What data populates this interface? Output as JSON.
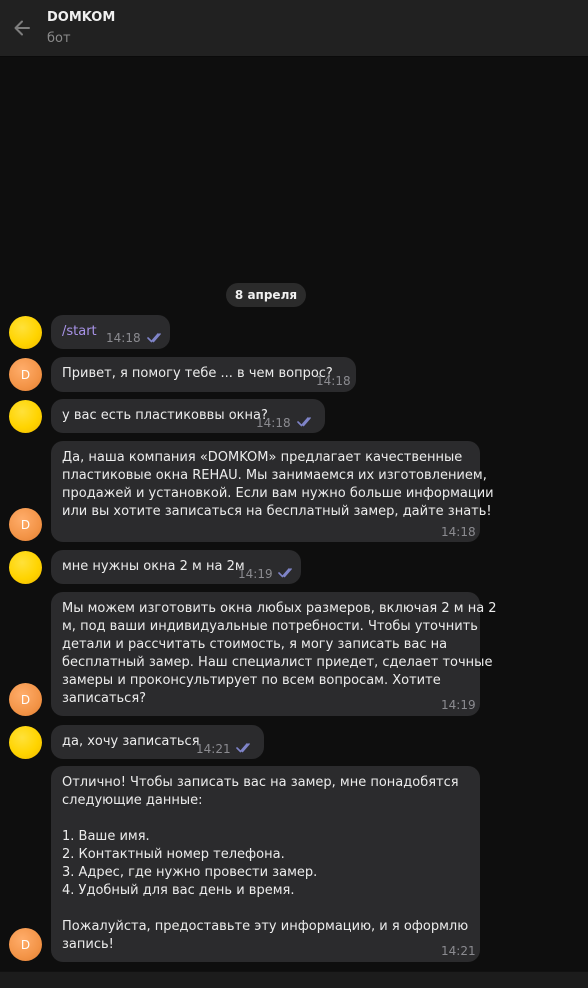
{
  "header": {
    "title": "DOMKOM",
    "subtitle": "бот"
  },
  "date_separator": "8 апреля",
  "avatars": {
    "bot_initial": "D"
  },
  "messages": [
    {
      "from": "user",
      "text": "/start",
      "time": "14:18"
    },
    {
      "from": "bot",
      "text": "Привет, я помогу тебе ... в чем вопрос?",
      "time": "14:18"
    },
    {
      "from": "user",
      "text": "у вас есть пластиковвы окна?",
      "time": "14:18"
    },
    {
      "from": "bot",
      "lines": [
        "Да, наша компания «DOMKOM» предлагает качественные",
        "пластиковые окна REHAU. Мы занимаемся их изготовлением,",
        "продажей и установкой. Если вам нужно больше информации",
        "или вы хотите записаться на бесплатный замер, дайте знать!"
      ],
      "time": "14:18"
    },
    {
      "from": "user",
      "text": "мне нужны окна 2 м на 2м",
      "time": "14:19"
    },
    {
      "from": "bot",
      "lines": [
        "Мы можем изготовить окна любых размеров, включая 2 м на 2",
        "м, под ваши индивидуальные потребности. Чтобы уточнить",
        "детали и рассчитать стоимость, я могу записать вас на",
        "бесплатный замер. Наш специалист приедет, сделает точные",
        "замеры и проконсультирует по всем вопросам. Хотите",
        "записаться?"
      ],
      "time": "14:19"
    },
    {
      "from": "user",
      "text": "да, хочу записаться",
      "time": "14:21"
    },
    {
      "from": "bot",
      "lines": [
        "Отлично! Чтобы записать вас на замер, мне понадобятся",
        "следующие данные:",
        "",
        "1. Ваше имя.",
        "2. Контактный номер телефона.",
        "3. Адрес, где нужно провести замер.",
        "4. Удобный для вас день и время.",
        "",
        "Пожалуйста, предоставьте эту информацию, и я оформлю",
        "запись!"
      ],
      "time": "14:21"
    }
  ],
  "colors": {
    "background": "#0e0e0e",
    "bubble": "#2b2b2d",
    "read_checks": "#7f84c8",
    "command_link": "#a893e8"
  }
}
